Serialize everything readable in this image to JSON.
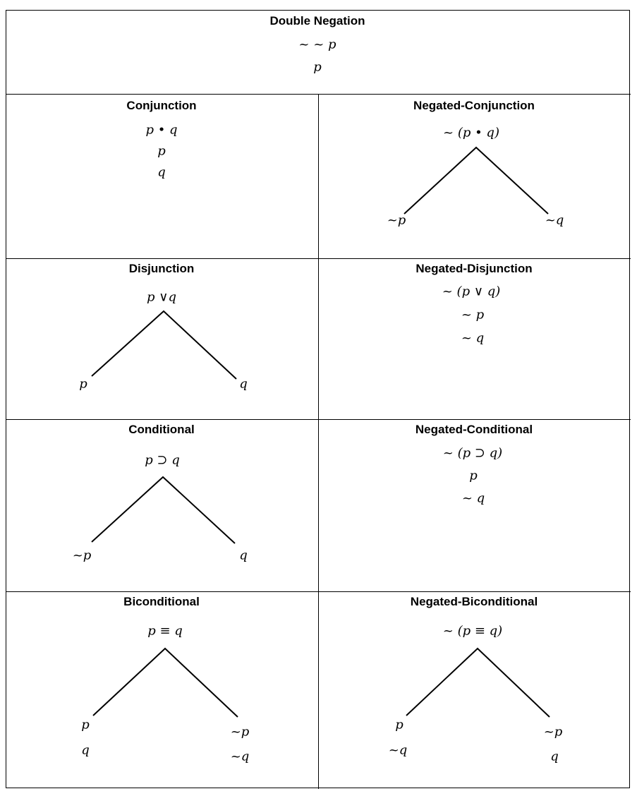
{
  "double_negation": {
    "title": "Double Negation",
    "lines": [
      "~ ~ p",
      "p"
    ]
  },
  "conjunction": {
    "title": "Conjunction",
    "lines": [
      "p • q",
      "p",
      "q"
    ]
  },
  "negated_conjunction": {
    "title": "Negated-Conjunction",
    "root": "~ (p • q)",
    "left": [
      "~p"
    ],
    "right": [
      "~q"
    ]
  },
  "disjunction": {
    "title": "Disjunction",
    "root": "p ∨q",
    "left": [
      "p"
    ],
    "right": [
      "q"
    ]
  },
  "negated_disjunction": {
    "title": "Negated-Disjunction",
    "lines": [
      "~ (p ∨ q)",
      "~ p",
      "~ q"
    ]
  },
  "conditional": {
    "title": "Conditional",
    "root": "p ⊃ q",
    "left": [
      "~p"
    ],
    "right": [
      "q"
    ]
  },
  "negated_conditional": {
    "title": "Negated-Conditional",
    "lines": [
      "~ (p ⊃ q)",
      "p",
      "~ q"
    ]
  },
  "biconditional": {
    "title": "Biconditional",
    "root": "p ≡ q",
    "left": [
      "p",
      "q"
    ],
    "right": [
      "~p",
      "~q"
    ]
  },
  "negated_biconditional": {
    "title": "Negated-Biconditional",
    "root": "~ (p ≡ q)",
    "left": [
      "p",
      "~q"
    ],
    "right": [
      "~p",
      "q"
    ]
  }
}
